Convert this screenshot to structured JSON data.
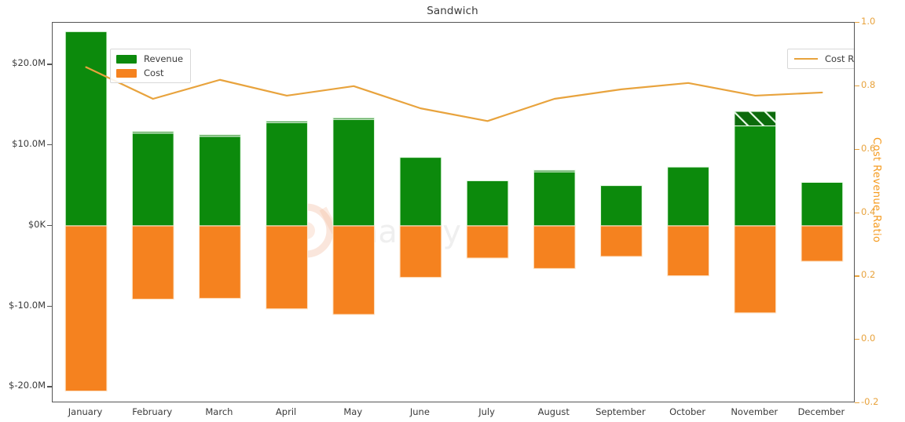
{
  "chart_data": {
    "type": "bar",
    "title": "Sandwich",
    "xlabel": "",
    "ylabel": "",
    "y2label": "Cost Revenue Ratio",
    "categories": [
      "January",
      "February",
      "March",
      "April",
      "May",
      "June",
      "July",
      "August",
      "September",
      "October",
      "November",
      "December"
    ],
    "grid": false,
    "legend_position": "top-left and top-right",
    "ylim": [
      -22.0,
      25.2
    ],
    "ytick_labels": [
      "$20.0M",
      "$10.0M",
      "$0K",
      "$-10.0M",
      "$-20.0M"
    ],
    "ytick_values": [
      20.0,
      10.0,
      0.0,
      -10.0,
      -20.0
    ],
    "y2lim": [
      -0.2,
      1.0
    ],
    "y2tick_labels": [
      "1.0",
      "0.8",
      "0.6",
      "0.4",
      "0.2",
      "0.0",
      "-0.2"
    ],
    "y2tick_values": [
      1.0,
      0.8,
      0.6,
      0.4,
      0.2,
      0.0,
      -0.2
    ],
    "series": [
      {
        "name": "Revenue",
        "type": "bar",
        "color": "#0c8a0c",
        "unit": "M",
        "values": [
          24.1,
          11.7,
          11.3,
          13.0,
          13.4,
          8.5,
          5.6,
          6.9,
          5.0,
          7.3,
          14.2,
          5.4
        ]
      },
      {
        "name": "Cost",
        "type": "bar",
        "color": "#f5821f",
        "unit": "M",
        "values": [
          -20.5,
          -9.1,
          -9.0,
          -10.3,
          -11.0,
          -6.4,
          -4.0,
          -5.3,
          -3.8,
          -6.2,
          -10.8,
          -4.4
        ]
      },
      {
        "name": "Cost Revenue Ratio",
        "type": "line",
        "color": "#e8a33d",
        "axis": "right",
        "values": [
          0.86,
          0.76,
          0.82,
          0.77,
          0.8,
          0.73,
          0.69,
          0.76,
          0.79,
          0.81,
          0.77,
          0.78
        ]
      }
    ],
    "revenue_sub_segments": [
      {
        "category": "February",
        "top": 11.7,
        "boundary": 11.5
      },
      {
        "category": "March",
        "top": 11.3,
        "boundary": 11.1
      },
      {
        "category": "April",
        "top": 13.0,
        "boundary": 12.8
      },
      {
        "category": "May",
        "top": 13.4,
        "boundary": 13.2
      },
      {
        "category": "August",
        "top": 6.9,
        "boundary": 6.7
      },
      {
        "category": "November",
        "top": 14.2,
        "boundary": 12.4,
        "hatched": true
      }
    ]
  },
  "legends": {
    "bars": [
      {
        "label": "Revenue",
        "color": "#0c8a0c",
        "icon": "green-square-icon"
      },
      {
        "label": "Cost",
        "color": "#f5821f",
        "icon": "orange-square-icon"
      }
    ],
    "line": {
      "label": "Cost Revenue Ratio",
      "color": "#e8a33d",
      "icon": "orange-line-icon"
    }
  },
  "watermark": {
    "text": "chartpy",
    "color": "#e8763a"
  }
}
